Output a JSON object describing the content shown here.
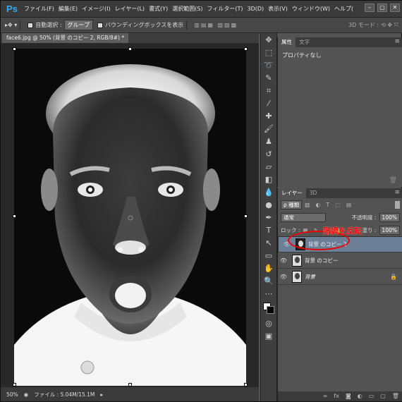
{
  "app": {
    "logo": "Ps"
  },
  "menu": [
    "ファイル(F)",
    "編集(E)",
    "イメージ(I)",
    "レイヤー(L)",
    "書式(Y)",
    "選択範囲(S)",
    "フィルター(T)",
    "3D(D)",
    "表示(V)",
    "ウィンドウ(W)",
    "ヘルプ("
  ],
  "window_buttons": {
    "minimize": "–",
    "restore": "▢",
    "close": "✕"
  },
  "options": {
    "auto_select_label": "自動選択 :",
    "auto_select_value": "グループ",
    "bounding_box_label": "バウンディングボックスを表示",
    "mode3d_label": "3D モード :"
  },
  "document": {
    "tab_title": "face6.jpg @ 50% (背景 のコピー 2, RGB/8#) *"
  },
  "status": {
    "zoom": "50%",
    "file_info": "ファイル : 5.04M/15.1M"
  },
  "properties_panel": {
    "tabs": [
      "属性",
      "文字"
    ],
    "body_text": "プロパティなし"
  },
  "layers_panel": {
    "tabs": [
      "レイヤー",
      "3D"
    ],
    "filter_label": "ρ 種類",
    "blend_mode": "通常",
    "opacity_label": "不透明度 :",
    "opacity_value": "100%",
    "lock_label": "ロック :",
    "fill_label": "塗り :",
    "fill_value": "100%",
    "layers": [
      {
        "name": "背景 のコピー 2",
        "selected": true
      },
      {
        "name": "背景 のコピー",
        "selected": false
      },
      {
        "name": "背景",
        "selected": false,
        "locked": true
      }
    ]
  },
  "annotation": {
    "text": "階調を反転",
    "color": "#e00000"
  }
}
